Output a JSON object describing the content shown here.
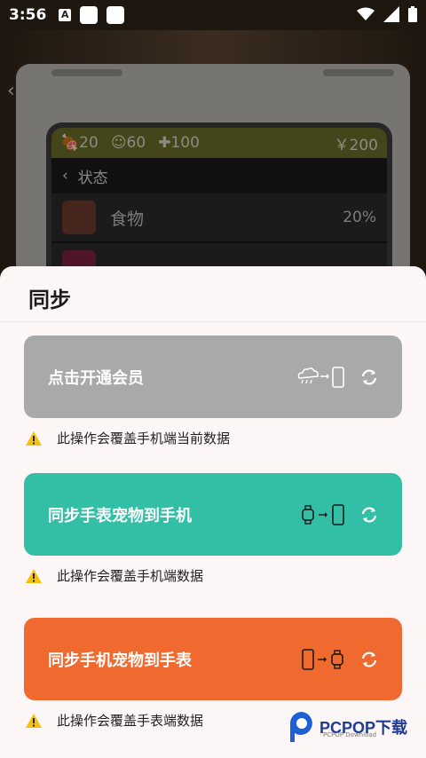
{
  "status_bar": {
    "time": "3:56",
    "app_icon_letter": "A"
  },
  "background": {
    "back_label": "返回",
    "stats": {
      "a": "20",
      "b": "60",
      "c": "100",
      "money": "￥200"
    },
    "section": "状态",
    "rows": [
      {
        "name": "食物",
        "value": "20%"
      }
    ]
  },
  "sheet": {
    "title": "同步",
    "options": [
      {
        "label": "点击开通会员",
        "warning": "此操作会覆盖手机端当前数据",
        "color": "#a9a9a9"
      },
      {
        "label": "同步手表宠物到手机",
        "warning": "此操作会覆盖手机端数据",
        "color": "#33bfa5"
      },
      {
        "label": "同步手机宠物到手表",
        "warning": "此操作会覆盖手表端数据",
        "color": "#f0692f"
      }
    ]
  },
  "watermark": {
    "brand": "PCPOP下载",
    "sub": "PCPOP Download"
  }
}
